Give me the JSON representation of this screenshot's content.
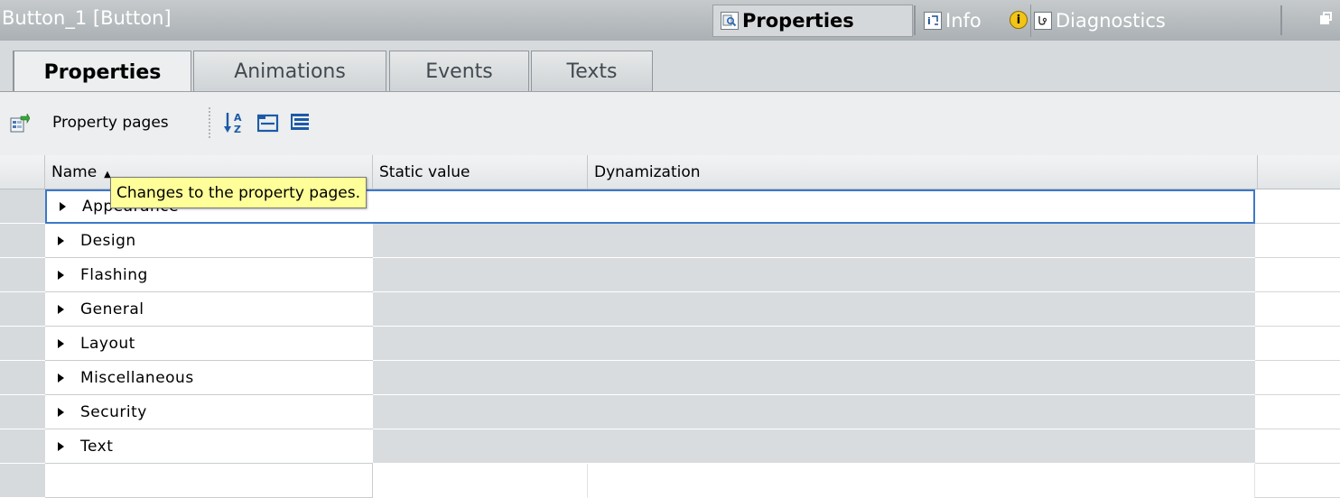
{
  "titlebar": {
    "object_title": "Button_1 [Button]",
    "tab_properties": "Properties",
    "tab_info": "Info",
    "info_badge": "i",
    "tab_diagnostics": "Diagnostics"
  },
  "tabs": [
    {
      "label": "Properties",
      "active": true
    },
    {
      "label": "Animations",
      "active": false
    },
    {
      "label": "Events",
      "active": false
    },
    {
      "label": "Texts",
      "active": false
    }
  ],
  "toolbar": {
    "property_pages_label": "Property pages"
  },
  "grid": {
    "columns": [
      "Name",
      "Static value",
      "Dynamization"
    ],
    "rows": [
      {
        "name": "Appearance"
      },
      {
        "name": "Design"
      },
      {
        "name": "Flashing"
      },
      {
        "name": "General"
      },
      {
        "name": "Layout"
      },
      {
        "name": "Miscellaneous"
      },
      {
        "name": "Security"
      },
      {
        "name": "Text"
      }
    ]
  },
  "tooltip": {
    "text": "Changes to the property pages."
  },
  "colors": {
    "selection_border": "#3c78c8",
    "tooltip_bg": "#ffff99",
    "info_badge": "#f2c418"
  }
}
